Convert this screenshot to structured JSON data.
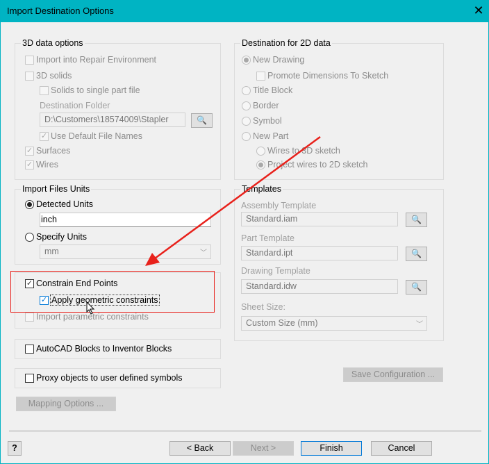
{
  "window": {
    "title": "Import Destination Options",
    "close": "✕"
  },
  "data3d": {
    "title": "3D data options",
    "import_repair": "Import into Repair Environment",
    "solids": "3D solids",
    "single_part": "Solids to single part file",
    "dest_folder_label": "Destination Folder",
    "dest_folder_value": "D:\\Customers\\18574009\\Stapler",
    "default_names": "Use Default File Names",
    "surfaces": "Surfaces",
    "wires": "Wires"
  },
  "dest2d": {
    "title": "Destination for 2D data",
    "new_drawing": "New Drawing",
    "promote": "Promote Dimensions To Sketch",
    "title_block": "Title Block",
    "border": "Border",
    "symbol": "Symbol",
    "new_part": "New Part",
    "wires3d": "Wires to 3D sketch",
    "project2d": "Project wires to 2D sketch"
  },
  "units": {
    "title": "Import Files Units",
    "detected": "Detected Units",
    "detected_value": "inch",
    "specify": "Specify Units",
    "specify_value": "mm"
  },
  "constrain": {
    "end_points": "Constrain End Points",
    "geometric": "Apply geometric constraints",
    "parametric": "Import parametric constraints"
  },
  "autocad_blocks": "AutoCAD Blocks to Inventor Blocks",
  "proxy": "Proxy objects to user defined symbols",
  "mapping": "Mapping Options ...",
  "templates": {
    "title": "Templates",
    "assembly_label": "Assembly Template",
    "assembly_value": "Standard.iam",
    "part_label": "Part Template",
    "part_value": "Standard.ipt",
    "drawing_label": "Drawing Template",
    "drawing_value": "Standard.idw",
    "sheet_label": "Sheet Size:",
    "sheet_value": "Custom Size (mm)"
  },
  "save_config": "Save Configuration ...",
  "footer": {
    "help": "?",
    "back": "< Back",
    "next": "Next >",
    "finish": "Finish",
    "cancel": "Cancel"
  },
  "annotation_color": "#e8211b"
}
